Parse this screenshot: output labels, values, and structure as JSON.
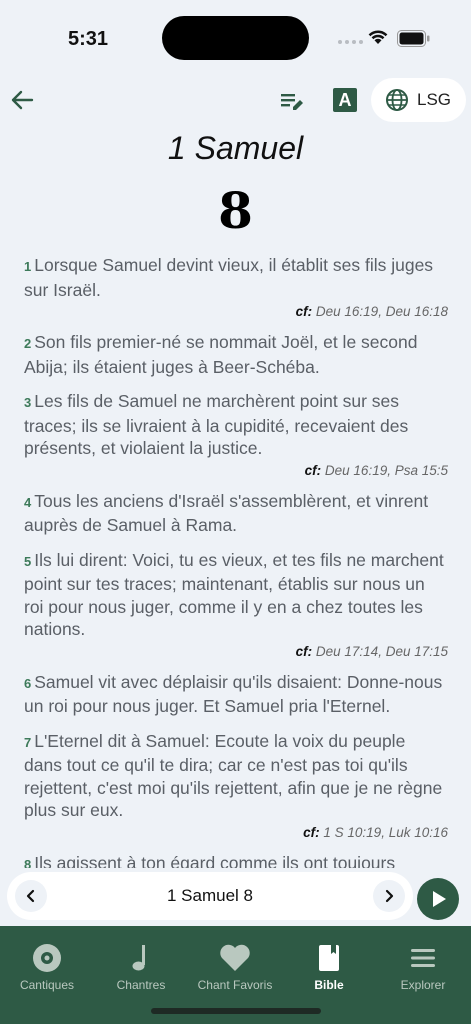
{
  "status": {
    "time": "5:31"
  },
  "header": {
    "version": "LSG",
    "book": "1 Samuel",
    "chapter": "8"
  },
  "verses": [
    {
      "n": "1",
      "text": "Lorsque Samuel devint vieux, il établit ses fils juges sur Israël.",
      "cf_label": "cf:",
      "cf": "Deu 16:19, Deu 16:18"
    },
    {
      "n": "2",
      "text": "Son fils premier-né se nommait Joël, et le second Abija; ils étaient juges à Beer-Schéba.",
      "cf_label": "",
      "cf": ""
    },
    {
      "n": "3",
      "text": "Les fils de Samuel ne marchèrent point sur ses traces; ils se livraient à la cupidité, recevaient des présents, et violaient la justice.",
      "cf_label": "cf:",
      "cf": "Deu 16:19, Psa 15:5"
    },
    {
      "n": "4",
      "text": "Tous les anciens d'Israël s'assemblèrent, et vinrent auprès de Samuel à Rama.",
      "cf_label": "",
      "cf": ""
    },
    {
      "n": "5",
      "text": "Ils lui dirent: Voici, tu es vieux, et tes fils ne marchent point sur tes traces; maintenant, établis sur nous un roi pour nous juger, comme il y en a chez toutes les nations.",
      "cf_label": "cf:",
      "cf": "Deu 17:14, Deu 17:15"
    },
    {
      "n": "6",
      "text": "Samuel vit avec déplaisir qu'ils disaient: Donne-nous un roi pour nous juger. Et Samuel pria l'Eternel.",
      "cf_label": "",
      "cf": ""
    },
    {
      "n": "7",
      "text": "L'Eternel dit à Samuel: Ecoute la voix du peuple dans tout ce qu'il te dira; car ce n'est pas toi qu'ils rejettent, c'est moi qu'ils rejettent, afin que je ne règne plus sur eux.",
      "cf_label": "cf:",
      "cf": "1 S 10:19, Luk 10:16"
    },
    {
      "n": "8",
      "text": "Ils agissent à ton égard comme ils ont toujours",
      "cf_label": "",
      "cf": ""
    }
  ],
  "nav": {
    "label": "1 Samuel 8"
  },
  "tabs": [
    {
      "label": "Cantiques",
      "icon": "disc-icon"
    },
    {
      "label": "Chantres",
      "icon": "music-note-icon"
    },
    {
      "label": "Chant Favoris",
      "icon": "heart-icon"
    },
    {
      "label": "Bible",
      "icon": "bible-book-icon",
      "active": true
    },
    {
      "label": "Explorer",
      "icon": "menu-icon"
    }
  ],
  "colors": {
    "accent": "#2e5a45",
    "verse_number": "#3d7a5a",
    "background": "#eef2f7"
  }
}
